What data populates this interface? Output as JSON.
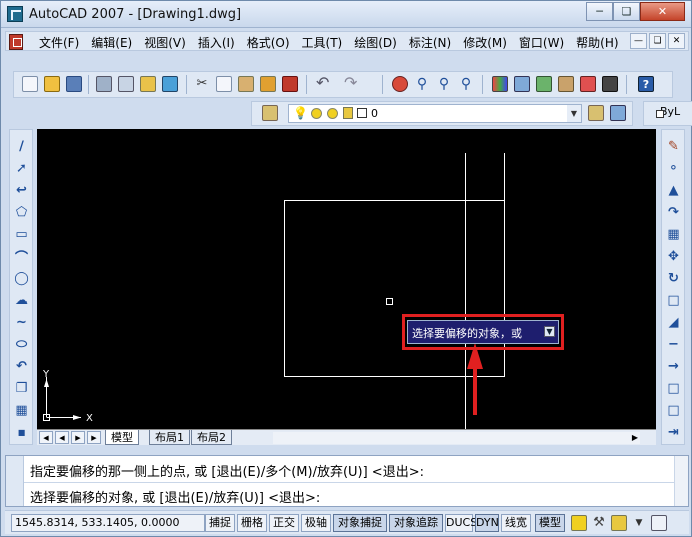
{
  "window": {
    "title": "AutoCAD 2007 - [Drawing1.dwg]"
  },
  "menu": {
    "items": [
      "文件(F)",
      "编辑(E)",
      "视图(V)",
      "插入(I)",
      "格式(O)",
      "工具(T)",
      "绘图(D)",
      "标注(N)",
      "修改(M)",
      "窗口(W)",
      "帮助(H)"
    ]
  },
  "layer": {
    "current": "0"
  },
  "properties": {
    "color": "ByL"
  },
  "canvas": {
    "tooltip": "选择要偏移的对象，或",
    "ucs_y": "Y",
    "ucs_x": "X"
  },
  "tabs": {
    "model": "模型",
    "layout1": "布局1",
    "layout2": "布局2"
  },
  "command": {
    "line1": "指定要偏移的那一侧上的点, 或 [退出(E)/多个(M)/放弃(U)] <退出>:",
    "line2": "选择要偏移的对象, 或 [退出(E)/放弃(U)] <退出>:"
  },
  "status": {
    "coords": "1545.8314, 533.1405, 0.0000",
    "buttons": [
      "捕捉",
      "栅格",
      "正交",
      "极轴",
      "对象捕捉",
      "对象追踪",
      "DUCS",
      "DYN",
      "线宽",
      "模型"
    ]
  },
  "colors": {
    "highlight": "#e02020",
    "tooltip_bg": "#1e1e6e"
  }
}
